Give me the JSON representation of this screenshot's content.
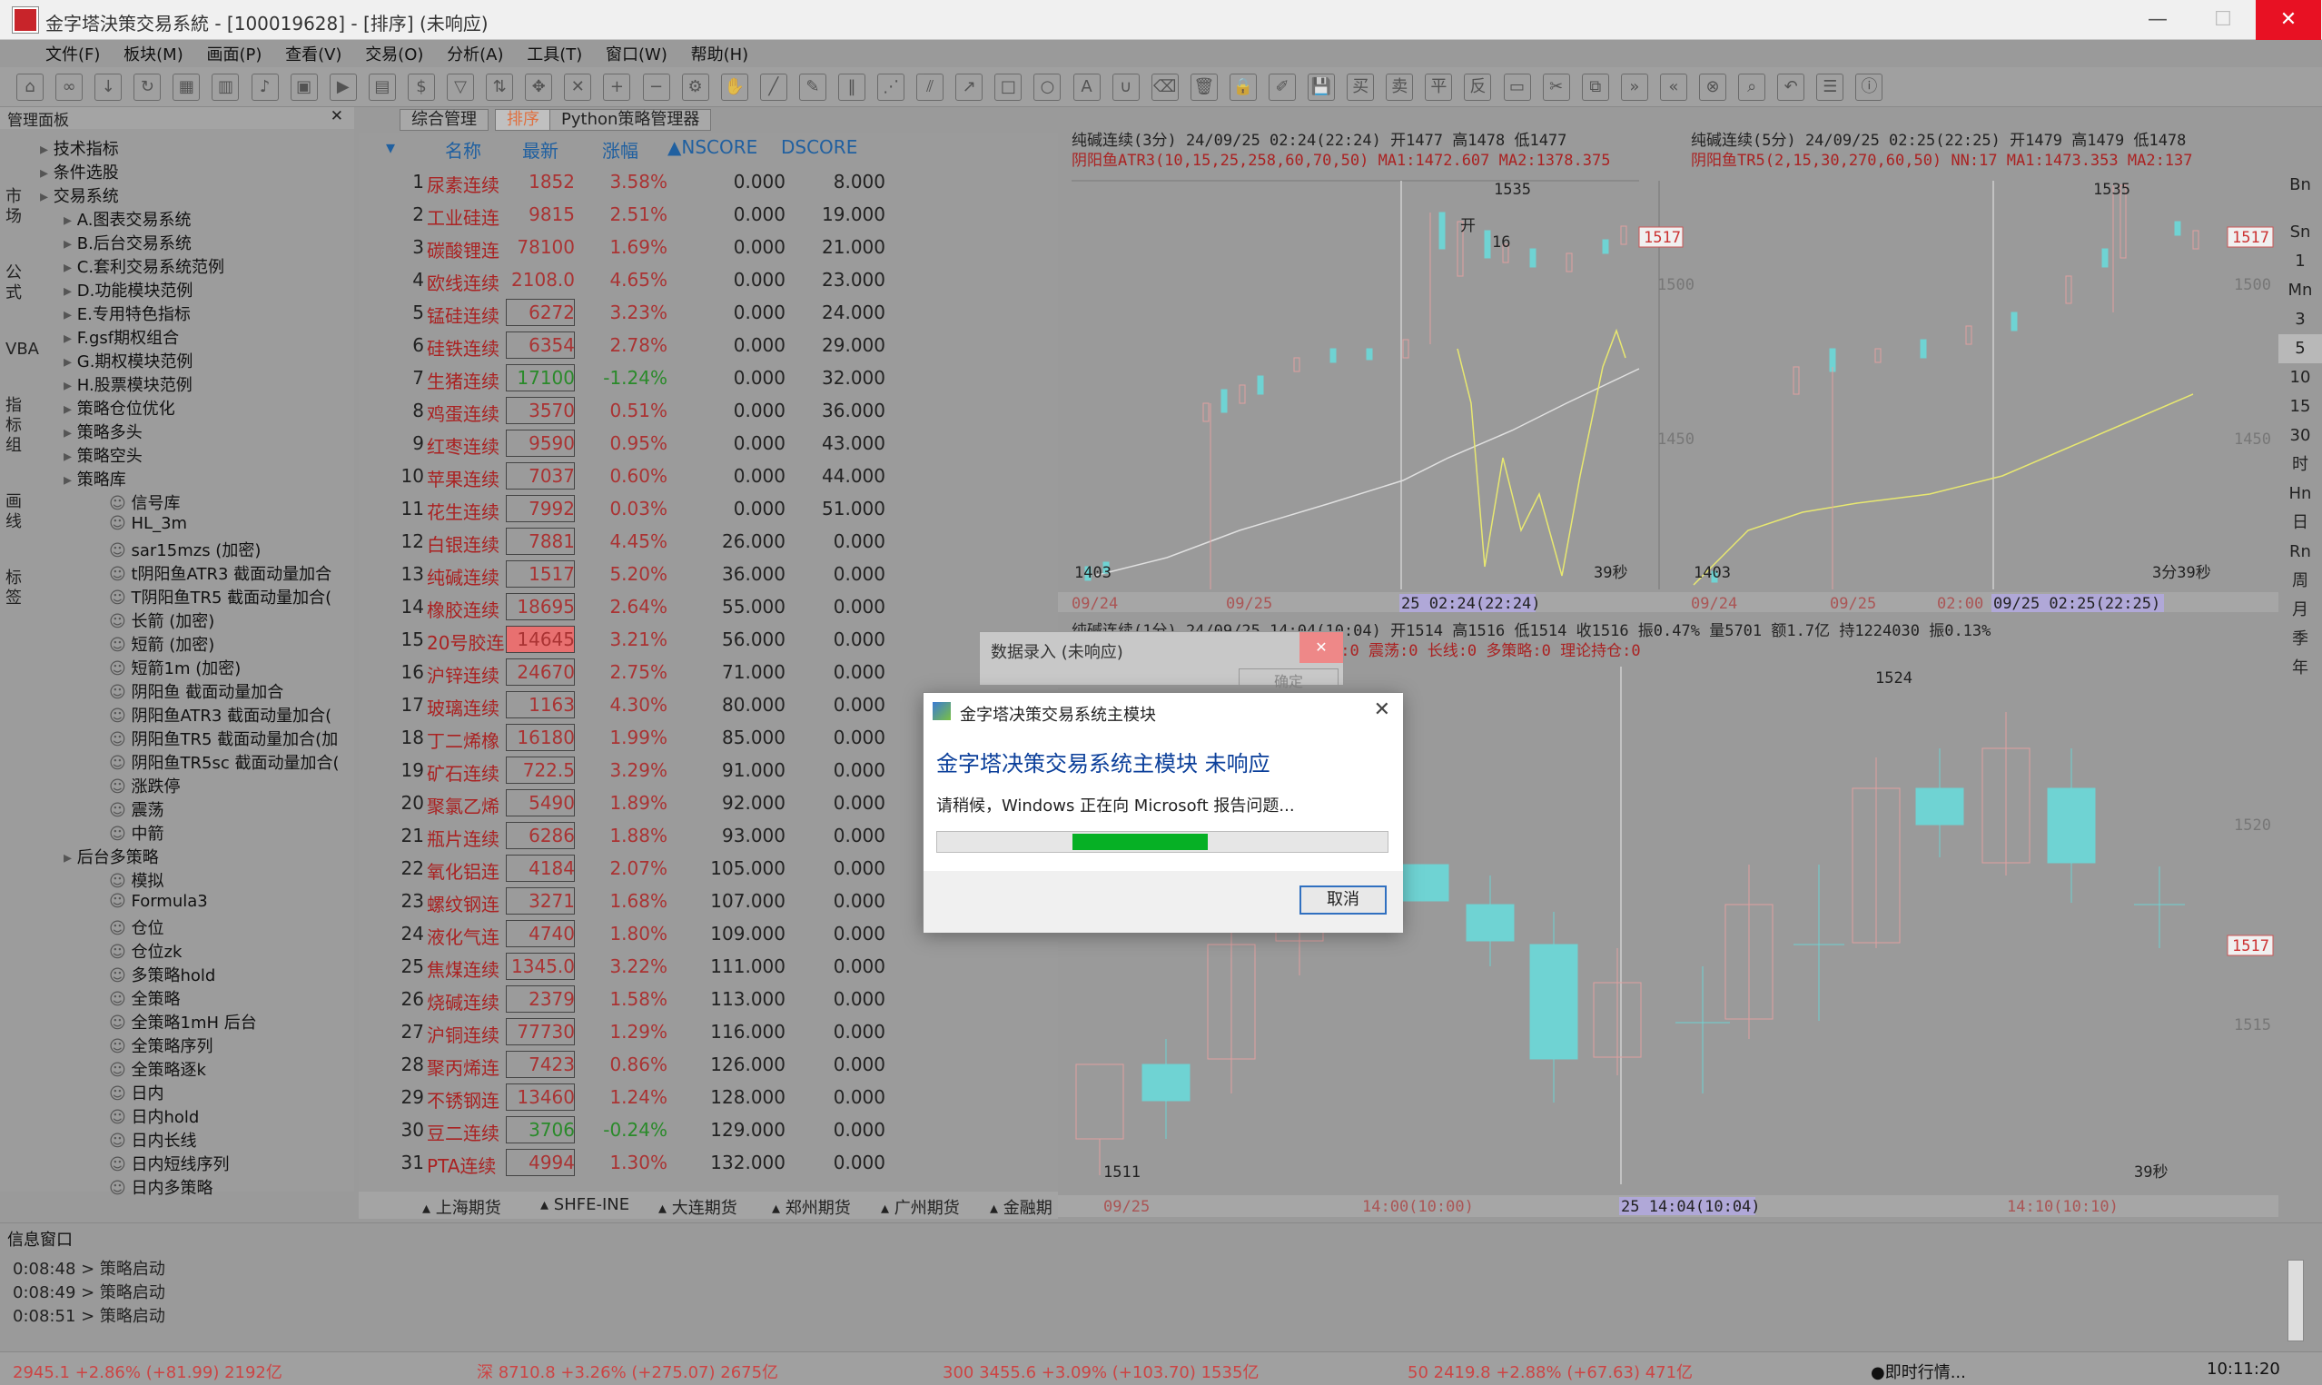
{
  "window": {
    "title": "金字塔決策交易系統 - [100019628] - [排序] (未响应)"
  },
  "menu": [
    "文件(F)",
    "板块(M)",
    "画面(P)",
    "查看(V)",
    "交易(O)",
    "分析(A)",
    "工具(T)",
    "窗口(W)",
    "帮助(H)"
  ],
  "left_panel": {
    "title": "管理面板",
    "items": [
      {
        "label": "技术指标",
        "level": 1
      },
      {
        "label": "条件选股",
        "level": 1
      },
      {
        "label": "交易系统",
        "level": 1
      },
      {
        "label": "A.图表交易系统",
        "level": 2
      },
      {
        "label": "B.后台交易系统",
        "level": 2
      },
      {
        "label": "C.套利交易系统范例",
        "level": 2
      },
      {
        "label": "D.功能模块范例",
        "level": 2
      },
      {
        "label": "E.专用特色指标",
        "level": 2
      },
      {
        "label": "F.gsf期权组合",
        "level": 2
      },
      {
        "label": "G.期权模块范例",
        "level": 2
      },
      {
        "label": "H.股票模块范例",
        "level": 2
      },
      {
        "label": "策略仓位优化",
        "level": 2
      },
      {
        "label": "策略多头",
        "level": 2
      },
      {
        "label": "策略空头",
        "level": 2
      },
      {
        "label": "策略库",
        "level": 2
      },
      {
        "label": "信号库",
        "level": 3
      },
      {
        "label": "HL_3m",
        "level": 3
      },
      {
        "label": "sar15mzs (加密)",
        "level": 3
      },
      {
        "label": "t阴阳鱼ATR3 截面动量加合",
        "level": 3
      },
      {
        "label": "T阴阳鱼TR5 截面动量加合(",
        "level": 3
      },
      {
        "label": "长箭 (加密)",
        "level": 3
      },
      {
        "label": "短箭 (加密)",
        "level": 3
      },
      {
        "label": "短箭1m (加密)",
        "level": 3
      },
      {
        "label": "阴阳鱼 截面动量加合",
        "level": 3
      },
      {
        "label": "阴阳鱼ATR3 截面动量加合(",
        "level": 3
      },
      {
        "label": "阴阳鱼TR5 截面动量加合(加",
        "level": 3
      },
      {
        "label": "阴阳鱼TR5sc 截面动量加合(",
        "level": 3
      },
      {
        "label": "涨跌停",
        "level": 3
      },
      {
        "label": "震荡",
        "level": 3
      },
      {
        "label": "中箭",
        "level": 3
      },
      {
        "label": "后台多策略",
        "level": 2
      },
      {
        "label": "模拟",
        "level": 3
      },
      {
        "label": "Formula3",
        "level": 3
      },
      {
        "label": "仓位",
        "level": 3
      },
      {
        "label": "仓位zk",
        "level": 3
      },
      {
        "label": "多策略hold",
        "level": 3
      },
      {
        "label": "全策略",
        "level": 3
      },
      {
        "label": "全策略1mH 后台",
        "level": 3
      },
      {
        "label": "全策略序列",
        "level": 3
      },
      {
        "label": "全策略逐k",
        "level": 3
      },
      {
        "label": "日内",
        "level": 3
      },
      {
        "label": "日内hold",
        "level": 3
      },
      {
        "label": "日内长线",
        "level": 3
      },
      {
        "label": "日内短线序列",
        "level": 3
      },
      {
        "label": "日内多策略",
        "level": 3
      }
    ],
    "vtabs": [
      "市场",
      "公式",
      "VBA",
      "指标组",
      "画线",
      "标签"
    ]
  },
  "mid_tabs": [
    "综合管理",
    "排序",
    "Python策略管理器"
  ],
  "grid": {
    "headers": [
      "名称",
      "最新",
      "涨幅",
      "▲NSCORE",
      "DSCORE"
    ],
    "rows": [
      [
        "1",
        "尿素连续",
        "1852",
        "3.58%",
        "0.000",
        "8.000"
      ],
      [
        "2",
        "工业硅连",
        "9815",
        "2.51%",
        "0.000",
        "19.000"
      ],
      [
        "3",
        "碳酸锂连",
        "78100",
        "1.69%",
        "0.000",
        "21.000"
      ],
      [
        "4",
        "欧线连续",
        "2108.0",
        "4.65%",
        "0.000",
        "23.000"
      ],
      [
        "5",
        "锰硅连续",
        "6272",
        "3.23%",
        "0.000",
        "24.000"
      ],
      [
        "6",
        "硅铁连续",
        "6354",
        "2.78%",
        "0.000",
        "29.000"
      ],
      [
        "7",
        "生猪连续",
        "17100",
        "-1.24%",
        "0.000",
        "32.000"
      ],
      [
        "8",
        "鸡蛋连续",
        "3570",
        "0.51%",
        "0.000",
        "36.000"
      ],
      [
        "9",
        "红枣连续",
        "9590",
        "0.95%",
        "0.000",
        "43.000"
      ],
      [
        "10",
        "苹果连续",
        "7037",
        "0.60%",
        "0.000",
        "44.000"
      ],
      [
        "11",
        "花生连续",
        "7992",
        "0.03%",
        "0.000",
        "51.000"
      ],
      [
        "12",
        "白银连续",
        "7881",
        "4.45%",
        "26.000",
        "0.000"
      ],
      [
        "13",
        "纯碱连续",
        "1517",
        "5.20%",
        "36.000",
        "0.000"
      ],
      [
        "14",
        "橡胶连续",
        "18695",
        "2.64%",
        "55.000",
        "0.000"
      ],
      [
        "15",
        "20号胶连",
        "14645",
        "3.21%",
        "56.000",
        "0.000"
      ],
      [
        "16",
        "沪锌连续",
        "24670",
        "2.75%",
        "71.000",
        "0.000"
      ],
      [
        "17",
        "玻璃连续",
        "1163",
        "4.30%",
        "80.000",
        "0.000"
      ],
      [
        "18",
        "丁二烯橡",
        "16180",
        "1.99%",
        "85.000",
        "0.000"
      ],
      [
        "19",
        "矿石连续",
        "722.5",
        "3.29%",
        "91.000",
        "0.000"
      ],
      [
        "20",
        "聚氯乙烯",
        "5490",
        "1.89%",
        "92.000",
        "0.000"
      ],
      [
        "21",
        "瓶片连续",
        "6286",
        "1.88%",
        "93.000",
        "0.000"
      ],
      [
        "22",
        "氧化铝连",
        "4184",
        "2.07%",
        "105.000",
        "0.000"
      ],
      [
        "23",
        "螺纹钢连",
        "3271",
        "1.68%",
        "107.000",
        "0.000"
      ],
      [
        "24",
        "液化气连",
        "4740",
        "1.80%",
        "109.000",
        "0.000"
      ],
      [
        "25",
        "焦煤连续",
        "1345.0",
        "3.22%",
        "111.000",
        "0.000"
      ],
      [
        "26",
        "烧碱连续",
        "2379",
        "1.58%",
        "113.000",
        "0.000"
      ],
      [
        "27",
        "沪铜连续",
        "77730",
        "1.29%",
        "116.000",
        "0.000"
      ],
      [
        "28",
        "聚丙烯连",
        "7423",
        "0.86%",
        "126.000",
        "0.000"
      ],
      [
        "29",
        "不锈钢连",
        "13460",
        "1.24%",
        "128.000",
        "0.000"
      ],
      [
        "30",
        "豆二连续",
        "3706",
        "-0.24%",
        "129.000",
        "0.000"
      ],
      [
        "31",
        "PTA连续",
        "4994",
        "1.30%",
        "132.000",
        "0.000"
      ]
    ]
  },
  "bottom_tabs": [
    "上海期货",
    "SHFE-INE",
    "大连期货",
    "郑州期货",
    "广州期货",
    "金融期"
  ],
  "charts": {
    "c1_title": "纯碱连续(3分) 24/09/25 02:24(22:24) 开1477 高1478 低1477",
    "c1_ind": "阴阳鱼ATR3(10,15,25,258,60,70,50) MA1:1472.607 MA2:1378.375",
    "c1_hi": "1535",
    "c1_lo": "1403",
    "c1_px": "1517",
    "c1_t": "39秒",
    "c1_open": "开",
    "c1_16": "16",
    "c1_y1": "1500",
    "c1_y2": "1450",
    "c1_d1": "09/24",
    "c1_d2": "09/25",
    "c1_d3": "25 02:24(22:24)",
    "c2_title": "纯碱连续(5分) 24/09/25 02:25(22:25) 开1479 高1479 低1478",
    "c2_ind": "阴阳鱼TR5(2,15,30,270,60,50) NN:17 MA1:1473.353 MA2:137",
    "c2_hi": "1535",
    "c2_lo": "1403",
    "c2_px": "1517",
    "c2_t": "3分39秒",
    "c2_y1": "1500",
    "c2_y2": "1450",
    "c2_d1": "09/24",
    "c2_d2": "09/25",
    "c2_d3": "02:00",
    "c2_d4": "09/25 02:25(22:25)",
    "c3_title": "纯碱连续(1分) 24/09/25 14:04(10:04) 开1514 高1516 低1514 收1516 振0.47% 量5701 额1.7亿 持1224030 振0.13%",
    "c3_ind": "龙5:0 短箭X:0 短箭:0 中箭:0 长箭:0 震荡:0 长线:0 多策略:0 理论持仓:0",
    "c3_hi": "1524",
    "c3_lo": "1511",
    "c3_px": "1517",
    "c3_t": "39秒",
    "c3_y1": "1520",
    "c3_y2": "1515",
    "c3_d1": "09/25",
    "c3_d2": "14:00(10:00)",
    "c3_d3": "25 14:04(10:04)",
    "c3_d4": "14:10(10:10)"
  },
  "dialog_bg": {
    "title": "数据录入 (未响应)",
    "btn": "确定"
  },
  "dialog": {
    "title": "金字塔决策交易系统主模块",
    "heading": "金字塔决策交易系统主模块 未响应",
    "message": "请稍候，Windows 正在向 Microsoft 报告问题...",
    "progress": 0.6,
    "cancel": "取消"
  },
  "messages": {
    "title": "信息窗口",
    "lines": [
      "0:08:48 > 策略启动",
      "0:08:49 > 策略启动",
      "0:08:51 > 策略启动"
    ]
  },
  "status": {
    "s1": "2945.1 +2.86% (+81.99) 2192亿",
    "s2": "深 8710.8 +3.26% (+275.07) 2675亿",
    "s3": "300 3455.6 +3.09% (+103.70) 1535亿",
    "s4": "50 2419.8 +2.88% (+67.63) 471亿",
    "s5": "●即时行情...",
    "time": "10:11:20"
  },
  "right_bar": [
    "Bn",
    "Sn",
    "1",
    "Mn",
    "3",
    "5",
    "10",
    "15",
    "30",
    "时",
    "Hn",
    "日",
    "Rn",
    "周",
    "月",
    "季",
    "年"
  ]
}
